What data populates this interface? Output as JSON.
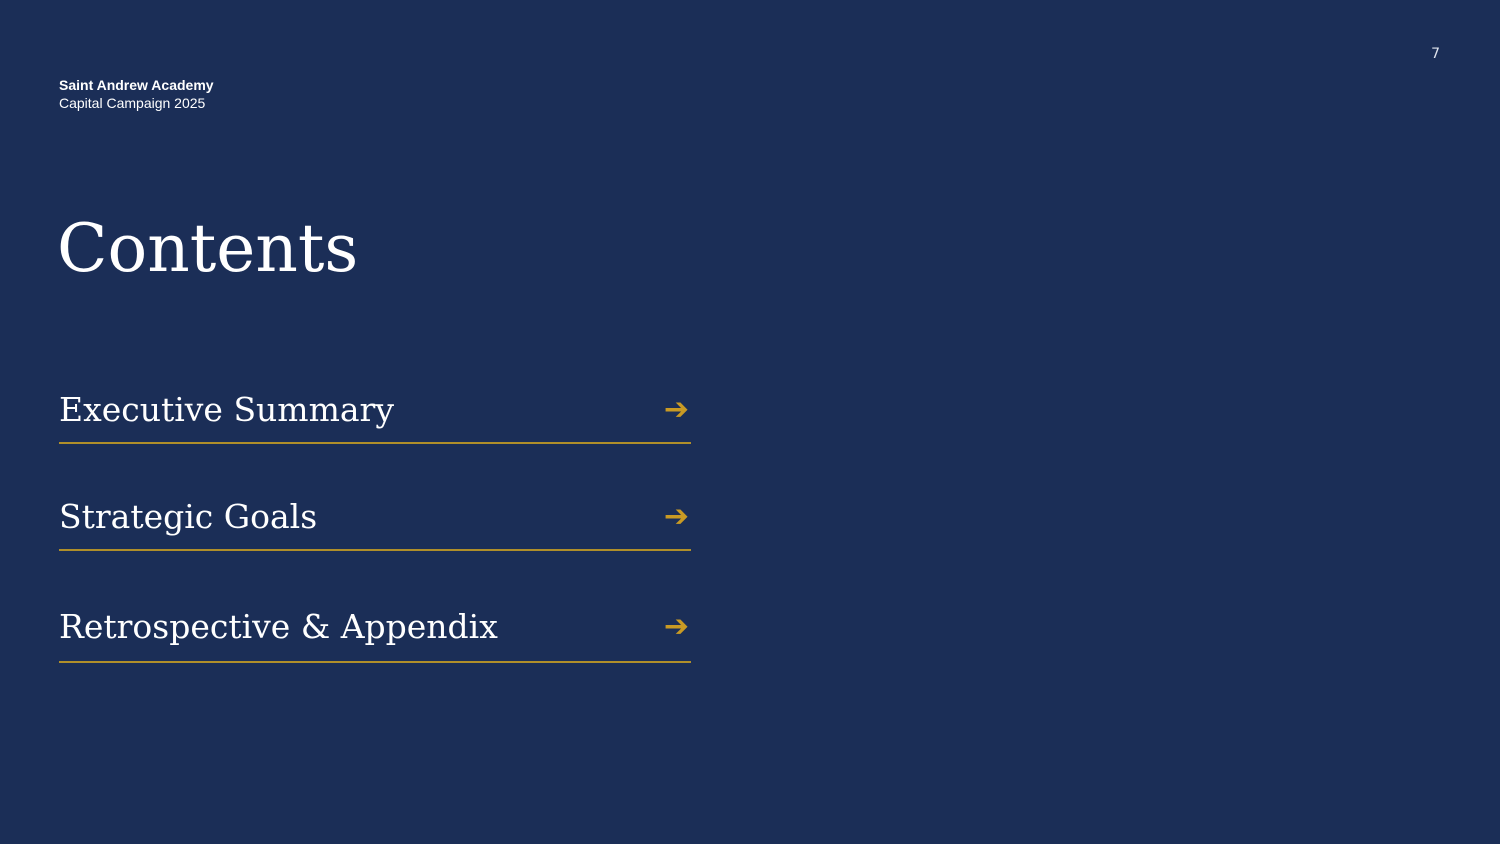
{
  "page": {
    "number": "7"
  },
  "brand": {
    "name": "Saint Andrew Academy",
    "subtitle": "Capital Campaign 2025"
  },
  "title": "Contents",
  "colors": {
    "background": "#1b2e57",
    "accent": "#c99a24",
    "divider": "#b08f2a",
    "text": "#ffffff"
  },
  "toc": {
    "items": [
      {
        "label": "Executive Summary",
        "icon": "arrow-right-icon",
        "arrow": "➔"
      },
      {
        "label": "Strategic Goals",
        "icon": "arrow-right-icon",
        "arrow": "➔"
      },
      {
        "label": "Retrospective & Appendix",
        "icon": "arrow-right-icon",
        "arrow": "➔"
      }
    ]
  }
}
